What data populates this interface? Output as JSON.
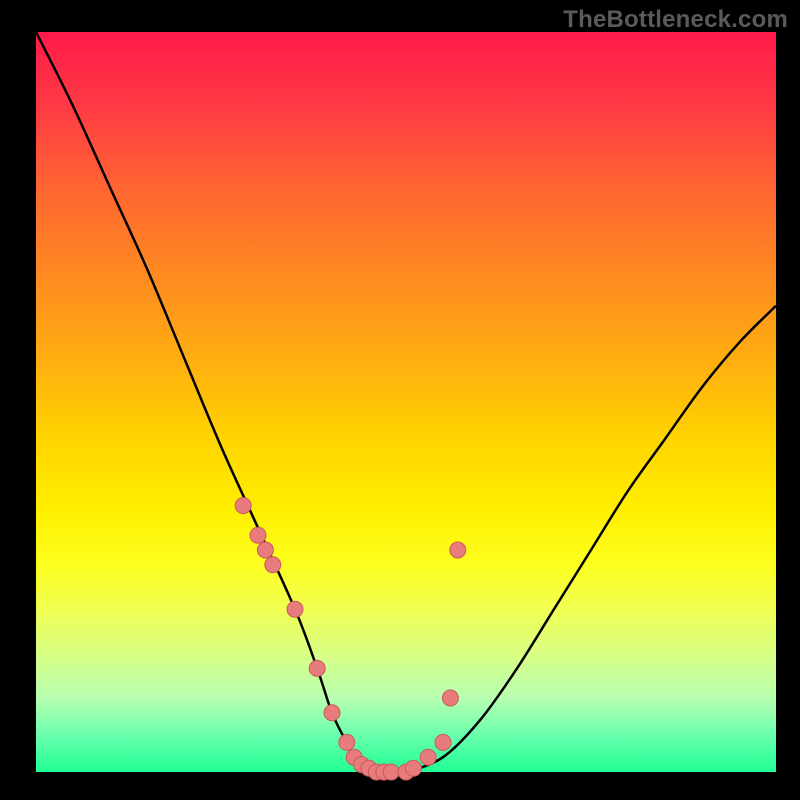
{
  "watermark": "TheBottleneck.com",
  "colors": {
    "frame": "#000000",
    "curve": "#000000",
    "marker_fill": "#e87b7b",
    "marker_stroke": "#c95a5a"
  },
  "chart_data": {
    "type": "line",
    "title": "",
    "xlabel": "",
    "ylabel": "",
    "xlim": [
      0,
      100
    ],
    "ylim": [
      0,
      100
    ],
    "series": [
      {
        "name": "curve",
        "x": [
          0,
          5,
          10,
          15,
          20,
          25,
          30,
          35,
          38,
          40,
          42,
          44,
          46,
          48,
          50,
          55,
          60,
          65,
          70,
          75,
          80,
          85,
          90,
          95,
          100
        ],
        "y": [
          100,
          90,
          79,
          68,
          56,
          44,
          33,
          22,
          14,
          8,
          4,
          1,
          0,
          0,
          0,
          2,
          7,
          14,
          22,
          30,
          38,
          45,
          52,
          58,
          63
        ]
      }
    ],
    "markers": {
      "name": "highlighted-points",
      "x": [
        28,
        30,
        31,
        32,
        35,
        38,
        40,
        42,
        43,
        44,
        45,
        46,
        47,
        48,
        50,
        51,
        53,
        55,
        56,
        57
      ],
      "y": [
        36,
        32,
        30,
        28,
        22,
        14,
        8,
        4,
        2,
        1,
        0.5,
        0,
        0,
        0,
        0,
        0.5,
        2,
        4,
        10,
        30
      ]
    }
  }
}
